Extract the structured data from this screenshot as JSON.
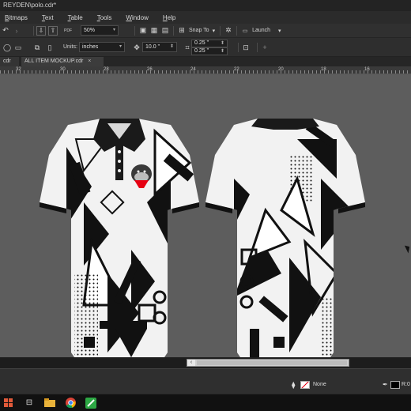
{
  "window": {
    "title": "REYDEN\\polo.cdr*"
  },
  "menu": {
    "items": [
      "Bitmaps",
      "Text",
      "Table",
      "Tools",
      "Window",
      "Help"
    ]
  },
  "toolbar": {
    "pdf_label": "PDF",
    "zoom_value": "50%",
    "snap_label": "Snap To",
    "launch_label": "Launch"
  },
  "property_bar": {
    "units_label": "Units:",
    "units_value": "inches",
    "rotation_value": "10.0 \"",
    "offset_x": "0.25 \"",
    "offset_y": "0.25 \""
  },
  "tabs": [
    {
      "label": "cdr"
    },
    {
      "label": "ALL ITEM MOCKUP.cdr"
    }
  ],
  "ruler": {
    "labels": [
      "32",
      "30",
      "28",
      "26",
      "24",
      "22",
      "20",
      "18",
      "16"
    ]
  },
  "status": {
    "fill_label": "None",
    "outline_label": "R:0"
  },
  "colors": {
    "canvas": "#5d5d5d",
    "shirt": "#f2f2f2",
    "pattern": "#111111",
    "accent": "#e60012"
  },
  "icons": [
    "undo-icon",
    "import-icon",
    "export-icon",
    "publish-pdf-icon",
    "full-screen-icon",
    "grid-icon",
    "rulers-icon",
    "snap-icon",
    "settings-icon",
    "add-page-icon",
    "windows-start-icon",
    "taskview-icon",
    "file-explorer-icon",
    "chrome-icon",
    "coreldraw-icon"
  ]
}
